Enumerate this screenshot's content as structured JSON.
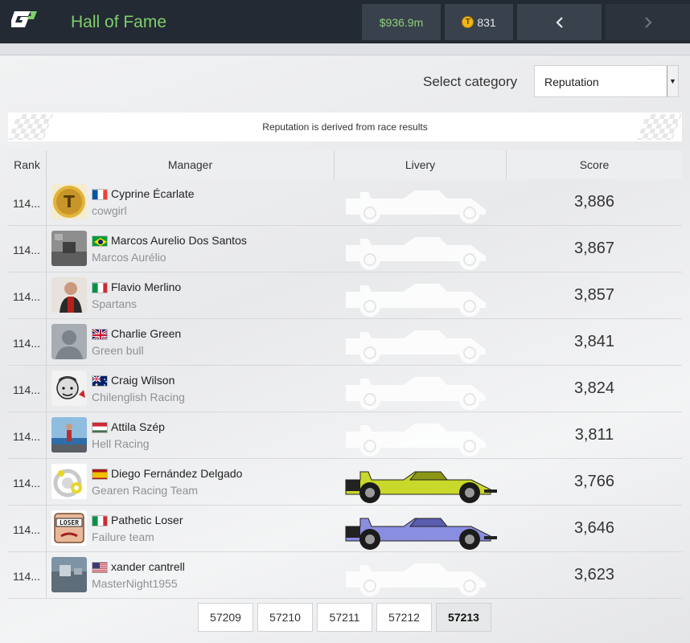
{
  "header": {
    "title": "Hall of Fame",
    "money": "$936.9m",
    "tokens": "831",
    "prev_label": "‹",
    "next_label": "›"
  },
  "category": {
    "label": "Select category",
    "selected": "Reputation"
  },
  "info": "Reputation is derived from race results",
  "table": {
    "headers": {
      "rank": "Rank",
      "manager": "Manager",
      "livery": "Livery",
      "score": "Score"
    },
    "rows": [
      {
        "rank": "114...",
        "name": "Cyprine Écarlate",
        "team": "cowgirl",
        "country": "France",
        "score": "3,886",
        "livery": "none"
      },
      {
        "rank": "114...",
        "name": "Marcos Aurelio Dos Santos",
        "team": "Marcos Aurélio",
        "country": "Brazil",
        "score": "3,867",
        "livery": "none"
      },
      {
        "rank": "114...",
        "name": "Flavio Merlino",
        "team": "Spartans",
        "country": "Italy",
        "score": "3,857",
        "livery": "none"
      },
      {
        "rank": "114...",
        "name": "Charlie Green",
        "team": "Green bull",
        "country": "United Kingdom",
        "score": "3,841",
        "livery": "none"
      },
      {
        "rank": "114...",
        "name": "Craig Wilson",
        "team": "Chilenglish Racing",
        "country": "Australia",
        "score": "3,824",
        "livery": "none"
      },
      {
        "rank": "114...",
        "name": "Attila Szép",
        "team": "Hell Racing",
        "country": "Hungary",
        "score": "3,811",
        "livery": "none"
      },
      {
        "rank": "114...",
        "name": "Diego Fernández Delgado",
        "team": "Gearen Racing Team",
        "country": "Spain",
        "score": "3,766",
        "livery": "lime"
      },
      {
        "rank": "114...",
        "name": "Pathetic Loser",
        "team": "Failure team",
        "country": "Italy",
        "score": "3,646",
        "livery": "purple"
      },
      {
        "rank": "114...",
        "name": "xander cantrell",
        "team": "MasterNight1955",
        "country": "United States",
        "score": "3,623",
        "livery": "none"
      }
    ]
  },
  "pagination": [
    "57209",
    "57210",
    "57211",
    "57212",
    "57213"
  ],
  "pagination_active": "57213",
  "colors": {
    "topbar": "#232a34",
    "accent_green": "#7fcf6a",
    "livery_lime": "#c9d82a",
    "livery_purple": "#8a8ee0"
  }
}
